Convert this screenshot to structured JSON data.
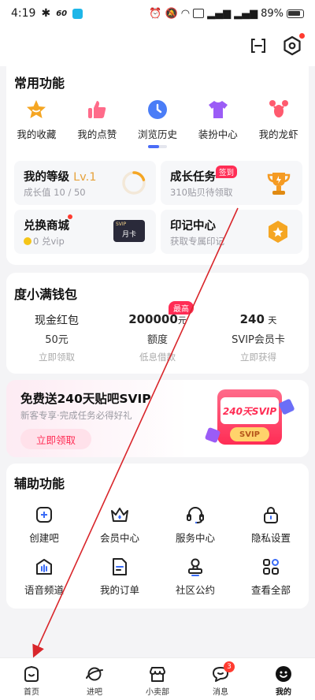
{
  "status_bar": {
    "time": "4:19",
    "net_speed": "60",
    "battery": "89%"
  },
  "common": {
    "title": "常用功能",
    "items": [
      {
        "label": "我的收藏",
        "icon": "star-icon"
      },
      {
        "label": "我的点赞",
        "icon": "thumbs-up-icon"
      },
      {
        "label": "浏览历史",
        "icon": "clock-icon"
      },
      {
        "label": "装扮中心",
        "icon": "tshirt-icon"
      },
      {
        "label": "我的龙虾",
        "icon": "lobster-icon"
      }
    ],
    "tiles": {
      "level": {
        "title": "我的等级",
        "level": "Lv.1",
        "sub": "成长值 10 / 50"
      },
      "growth": {
        "title": "成长任务",
        "badge": "签到",
        "sub": "310贴贝待领取"
      },
      "shop": {
        "title": "兑换商城",
        "sub": "0 兑vip",
        "card_tag": "SVIP",
        "card_label": "月卡"
      },
      "mark": {
        "title": "印记中心",
        "sub": "获取专属印记"
      }
    }
  },
  "wallet": {
    "title": "度小满钱包",
    "items": [
      {
        "top": "现金红包",
        "mid": "50元",
        "bot": "立即领取"
      },
      {
        "top_value": "200000",
        "top_unit": "元",
        "mid": "额度",
        "bot": "低息借款",
        "badge": "最高"
      },
      {
        "top_value": "240",
        "top_unit": "天",
        "mid": "SVIP会员卡",
        "bot": "立即获得"
      }
    ]
  },
  "banner": {
    "title": "免费送240天贴吧SVIP",
    "sub": "新客专享·完成任务必得好礼",
    "button": "立即领取",
    "art_text": "240天SVIP",
    "art_tag": "SVIP"
  },
  "aux": {
    "title": "辅助功能",
    "items": [
      {
        "label": "创建吧",
        "icon": "plus-square-icon"
      },
      {
        "label": "会员中心",
        "icon": "crown-icon"
      },
      {
        "label": "服务中心",
        "icon": "headset-icon"
      },
      {
        "label": "隐私设置",
        "icon": "lock-icon"
      },
      {
        "label": "语音频道",
        "icon": "voice-channel-icon"
      },
      {
        "label": "我的订单",
        "icon": "order-icon"
      },
      {
        "label": "社区公约",
        "icon": "stamp-icon"
      },
      {
        "label": "查看全部",
        "icon": "grid-icon"
      }
    ]
  },
  "nav": {
    "items": [
      {
        "label": "首页",
        "icon": "home-icon"
      },
      {
        "label": "进吧",
        "icon": "planet-icon"
      },
      {
        "label": "小卖部",
        "icon": "shop-icon"
      },
      {
        "label": "消息",
        "icon": "message-icon",
        "badge": "3"
      },
      {
        "label": "我的",
        "icon": "profile-icon"
      }
    ]
  }
}
